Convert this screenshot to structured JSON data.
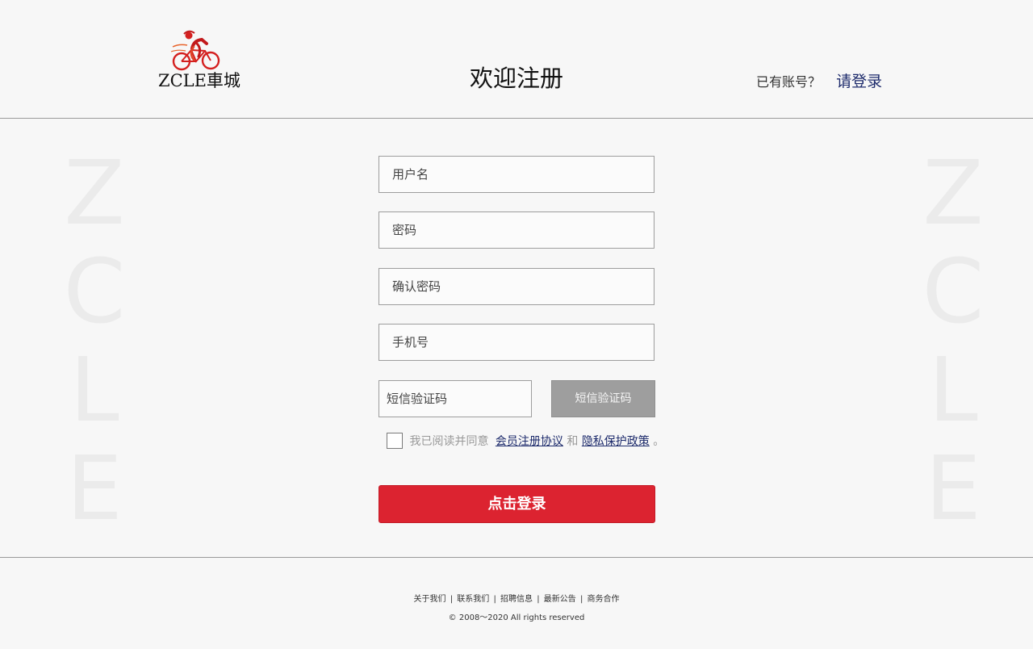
{
  "header": {
    "logo_text": "ZCLE車城",
    "title": "欢迎注册",
    "login_prompt": "已有账号？",
    "login_link": "请登录"
  },
  "watermark": {
    "letters": [
      "Z",
      "C",
      "L",
      "E"
    ]
  },
  "form": {
    "username_placeholder": "用户名",
    "password_placeholder": "密码",
    "confirm_placeholder": "确认密码",
    "phone_placeholder": "手机号",
    "sms_placeholder": "短信验证码",
    "sms_button": "短信验证码",
    "agree_text": "我已阅读并同意",
    "agreement_link": "会员注册协议",
    "and_text": "和",
    "privacy_link": "隐私保护政策",
    "period": "。",
    "submit": "点击登录"
  },
  "footer": {
    "links": [
      "关于我们",
      "联系我们",
      "招聘信息",
      "最新公告",
      "商务合作"
    ],
    "separator": "|",
    "copyright": "© 2008～2020 All rights reserved"
  },
  "colors": {
    "background": "#f7f7f7",
    "accent_red": "#dc2330",
    "link_blue": "#1c2a6b",
    "sms_button_gray": "#9e9e9e",
    "logo_red": "#d4201f"
  },
  "icons": {
    "logo": "cyclist-logo-icon"
  }
}
